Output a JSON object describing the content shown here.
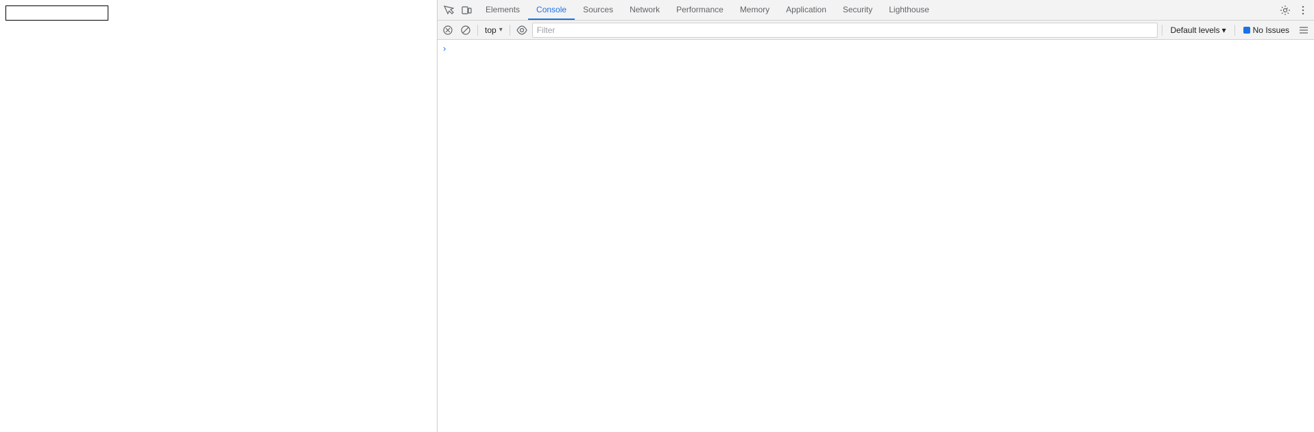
{
  "page": {
    "input_placeholder": ""
  },
  "devtools": {
    "tabs": [
      {
        "id": "elements",
        "label": "Elements",
        "active": false
      },
      {
        "id": "console",
        "label": "Console",
        "active": true
      },
      {
        "id": "sources",
        "label": "Sources",
        "active": false
      },
      {
        "id": "network",
        "label": "Network",
        "active": false
      },
      {
        "id": "performance",
        "label": "Performance",
        "active": false
      },
      {
        "id": "memory",
        "label": "Memory",
        "active": false
      },
      {
        "id": "application",
        "label": "Application",
        "active": false
      },
      {
        "id": "security",
        "label": "Security",
        "active": false
      },
      {
        "id": "lighthouse",
        "label": "Lighthouse",
        "active": false
      }
    ],
    "toolbar": {
      "inspect_icon": "⬚",
      "device_icon": "⬜"
    },
    "console_toolbar": {
      "clear_icon": "🚫",
      "block_icon": "⊘",
      "context_label": "top",
      "eye_icon": "👁",
      "filter_placeholder": "Filter",
      "log_levels_label": "Default levels",
      "log_levels_arrow": "▾",
      "no_issues_label": "No Issues"
    },
    "console_content": {
      "chevron": "›"
    },
    "settings_icon": "⚙",
    "more_icon": "⋮",
    "right_icon": "≡"
  }
}
